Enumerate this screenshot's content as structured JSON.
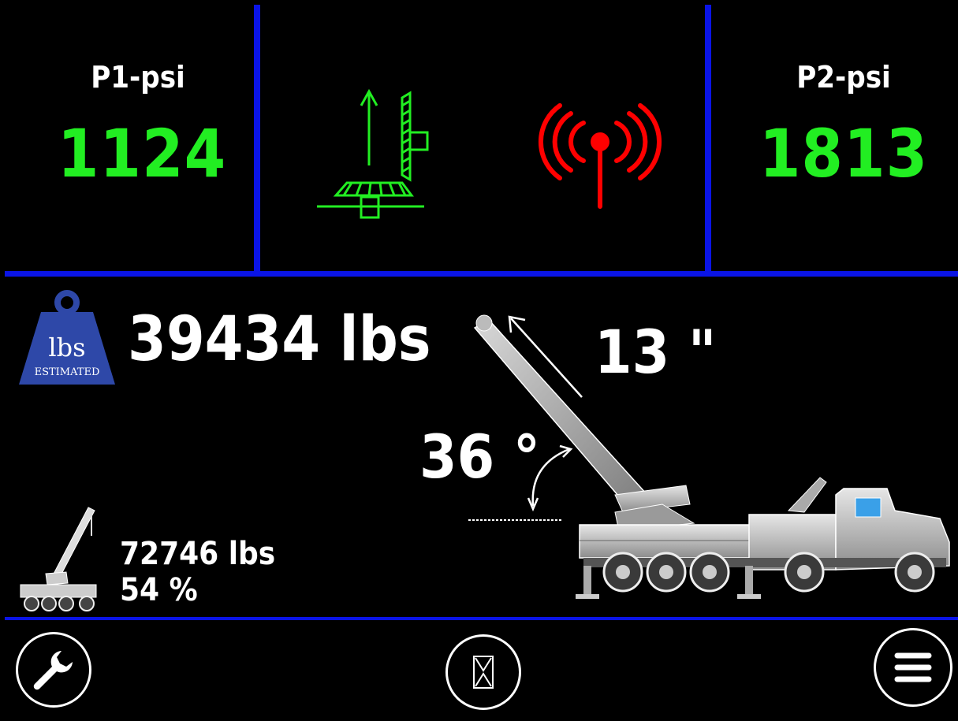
{
  "top": {
    "p1": {
      "label": "P1-psi",
      "value": "1124"
    },
    "p2": {
      "label": "P2-psi",
      "value": "1813"
    }
  },
  "status": {
    "outrigger_icon": "outrigger-level-icon",
    "outrigger_color": "#22ee22",
    "wireless_icon": "wireless-signal-icon",
    "wireless_color": "#ff0000"
  },
  "load": {
    "weight_text": "39434 lbs",
    "weight_badge_top": "lbs",
    "weight_badge_bottom": "ESTIMATED",
    "extension_text": "13 \"",
    "angle_text": "36 °",
    "capacity_text": "72746 lbs",
    "capacity_percent": "54 %"
  },
  "toolbar": {
    "settings_icon": "wrench-icon",
    "timer_icon": "hourglass-icon",
    "menu_icon": "hamburger-menu-icon"
  },
  "colors": {
    "divider": "#0a14e6",
    "value_green": "#22ee22",
    "alert_red": "#ff0000"
  }
}
